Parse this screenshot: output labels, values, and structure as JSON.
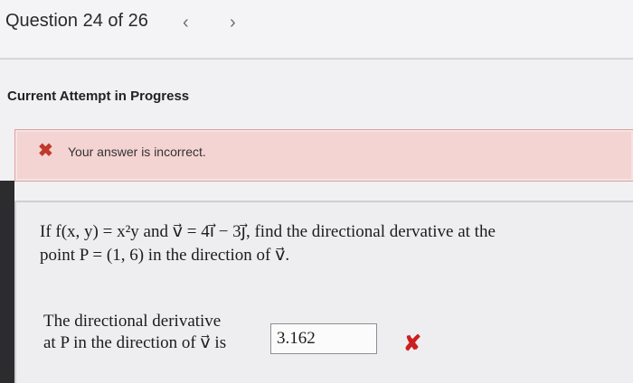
{
  "header": {
    "title": "Question 24 of 26",
    "prev_icon": "‹",
    "next_icon": "›"
  },
  "attempt": {
    "label": "Current Attempt in Progress"
  },
  "feedback": {
    "icon": "✖",
    "message": "Your answer is incorrect.",
    "color": "#f4d3d3"
  },
  "question": {
    "line1": "If f(x, y) = x²y and v⃗ = 4i⃗ − 3j⃗, find the directional dervative at the",
    "line2": "point P = (1, 6) in the direction of v⃗.",
    "answer_line1": "The directional derivative",
    "answer_line2": "at P in the direction of v⃗ is",
    "answer_value": "3.162",
    "result_icon": "✘"
  }
}
